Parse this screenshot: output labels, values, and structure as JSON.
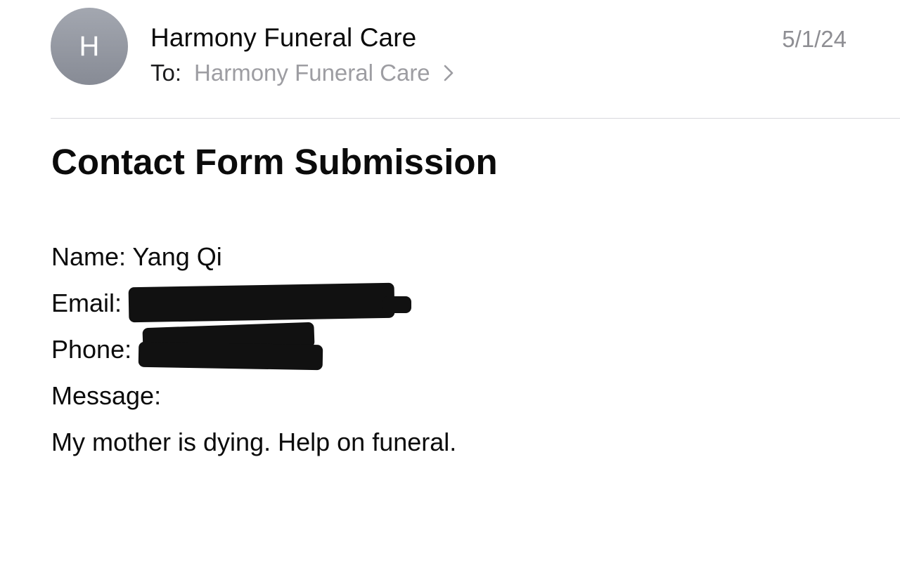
{
  "header": {
    "avatar_initial": "H",
    "sender_name": "Harmony Funeral Care",
    "date": "5/1/24",
    "to_label": "To:",
    "recipient": "Harmony Funeral Care"
  },
  "subject": "Contact Form Submission",
  "body": {
    "name_line": "Name: Yang Qi",
    "email_label": "Email:",
    "phone_label": "Phone:",
    "message_label": "Message:",
    "message_text": "My mother is dying. Help on funeral."
  },
  "icons": {
    "chevron": "chevron-right-icon"
  },
  "colors": {
    "avatar": "#8e929b",
    "secondary_text": "#9d9da2",
    "redaction": "#111111"
  }
}
